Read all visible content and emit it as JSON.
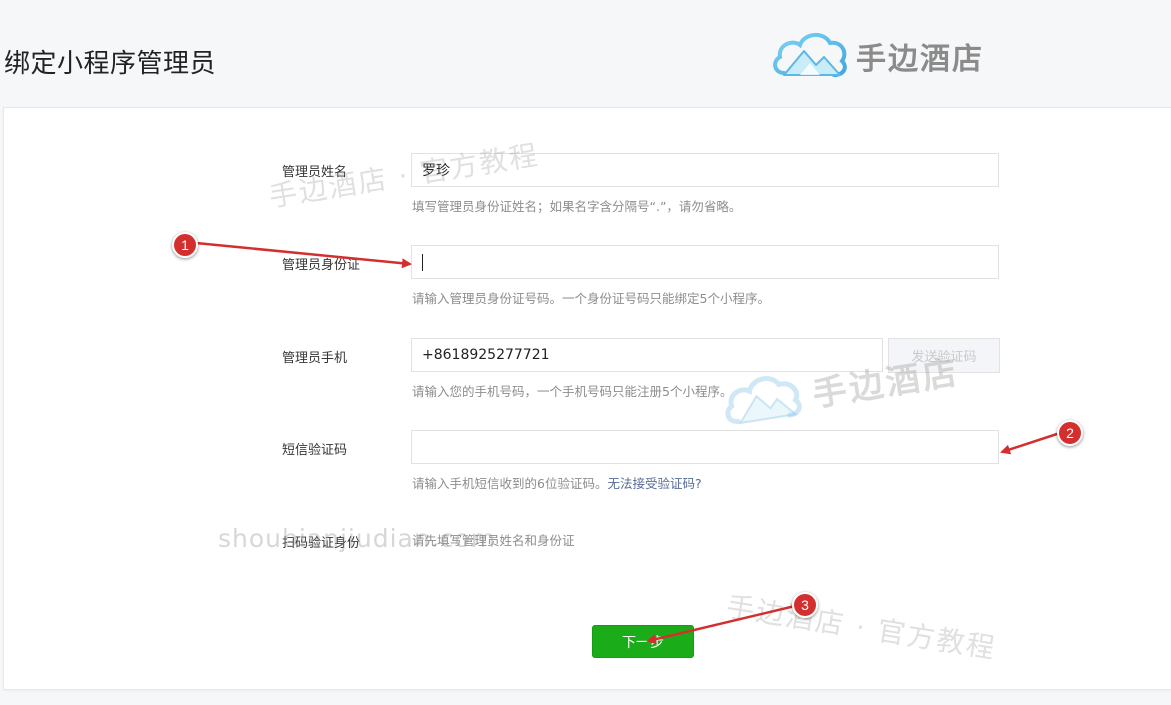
{
  "header": {
    "title": "绑定小程序管理员",
    "brand_name": "手边酒店"
  },
  "form": {
    "name": {
      "label": "管理员姓名",
      "value": "罗珍",
      "hint": "填写管理员身份证姓名；如果名字含分隔号“.”，请勿省略。"
    },
    "id_card": {
      "label": "管理员身份证",
      "value": "",
      "hint": "请输入管理员身份证号码。一个身份证号码只能绑定5个小程序。"
    },
    "phone": {
      "label": "管理员手机",
      "value": "+8618925277721",
      "send_code_button": "发送验证码",
      "hint": "请输入您的手机号码，一个手机号码只能注册5个小程序。"
    },
    "sms_code": {
      "label": "短信验证码",
      "value": "",
      "hint": "请输入手机短信收到的6位验证码。",
      "help_link": "无法接受验证码?"
    },
    "scan_verify": {
      "label": "扫码验证身份",
      "text": "请先填写管理员姓名和身份证"
    },
    "next_button": "下一步"
  },
  "watermarks": {
    "caption_1": "手边酒店 · 官方教程",
    "caption_2": "手边酒店 · 官方教程",
    "brand": "手边酒店",
    "url": "shoubianjiudian.com"
  },
  "annotations": {
    "steps": [
      "1",
      "2",
      "3"
    ],
    "color": "#d42f2f"
  },
  "colors": {
    "primary_button": "#1aad19",
    "link": "#576b95",
    "hint_text": "#8d8d8d"
  }
}
